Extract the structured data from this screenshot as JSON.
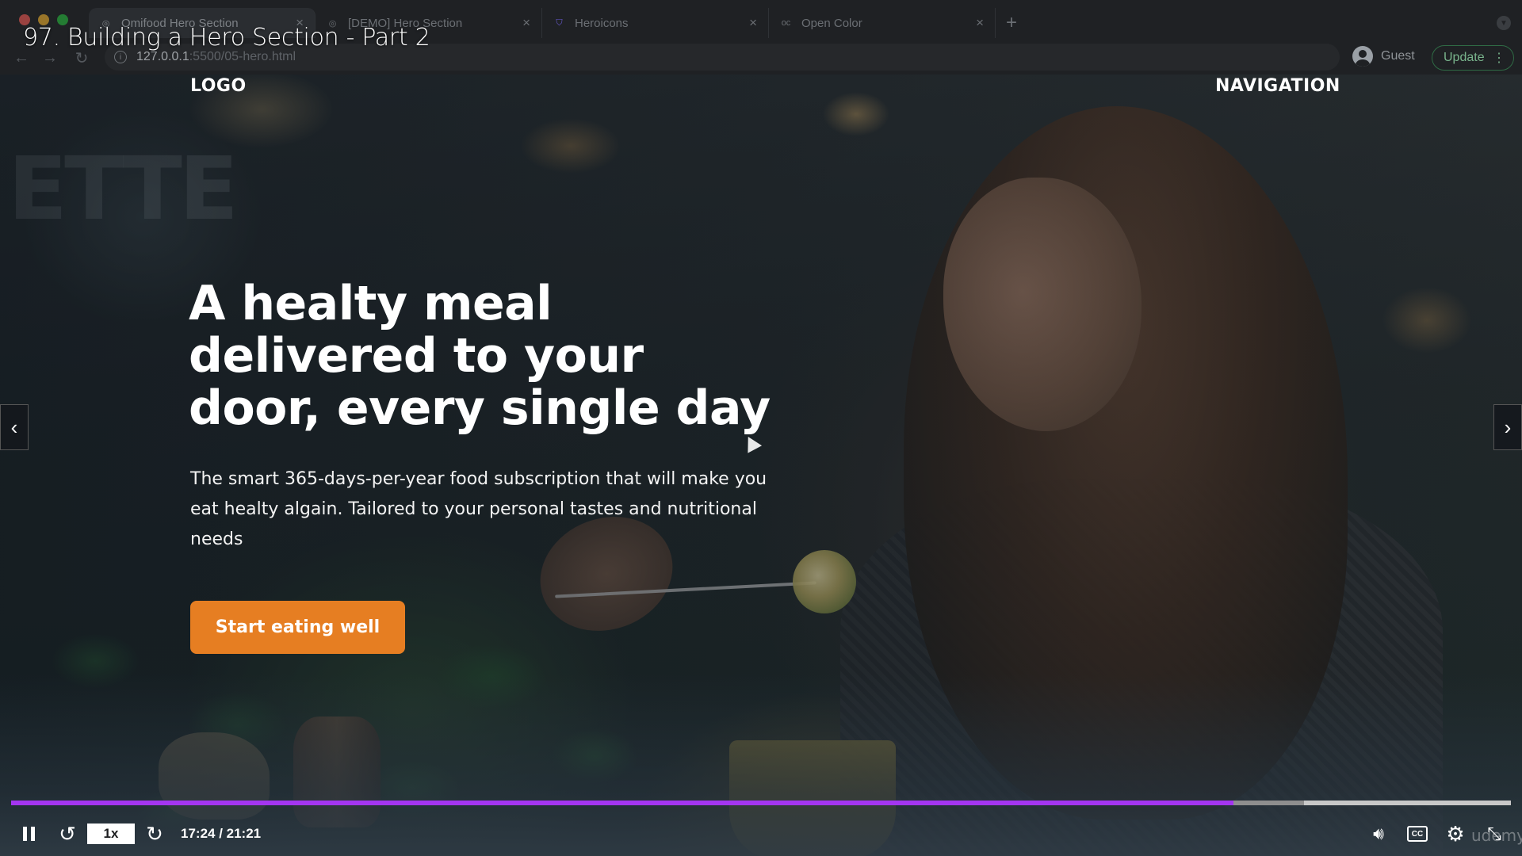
{
  "video": {
    "title": "97. Building a Hero Section - Part 2"
  },
  "browser": {
    "tabs": [
      {
        "label": "Omifood Hero Section",
        "icon": "globe-icon",
        "active": true
      },
      {
        "label": "[DEMO] Hero Section",
        "icon": "globe-icon",
        "active": false
      },
      {
        "label": "Heroicons",
        "icon": "shield-icon",
        "active": false
      },
      {
        "label": "Open Color",
        "icon": "oc-icon",
        "active": false
      }
    ],
    "url_host": "127.0.0.1",
    "url_path": ":5500/05-hero.html",
    "profile_label": "Guest",
    "update_label": "Update"
  },
  "hero": {
    "logo": "LOGO",
    "navigation": "NAVIGATION",
    "heading": "A healty meal delivered to your door, every single day",
    "description": "The smart 365-days-per-year food subscription that will make you eat healty algain. Tailored to your personal tastes and nutritional needs",
    "cta_label": "Start eating well",
    "accent_color": "#e67e22"
  },
  "player": {
    "speed": "1x",
    "time": "17:24 / 21:21",
    "progress_played": 0.8152,
    "progress_buffered": 0.862,
    "progress_color": "#a435f0",
    "watermark": "udemy",
    "icons": [
      "pause-icon",
      "rewind-icon",
      "forward-icon",
      "volume-icon",
      "captions-icon",
      "settings-icon",
      "fullscreen-exit-icon",
      "prev-arrow-icon",
      "next-arrow-icon"
    ]
  }
}
